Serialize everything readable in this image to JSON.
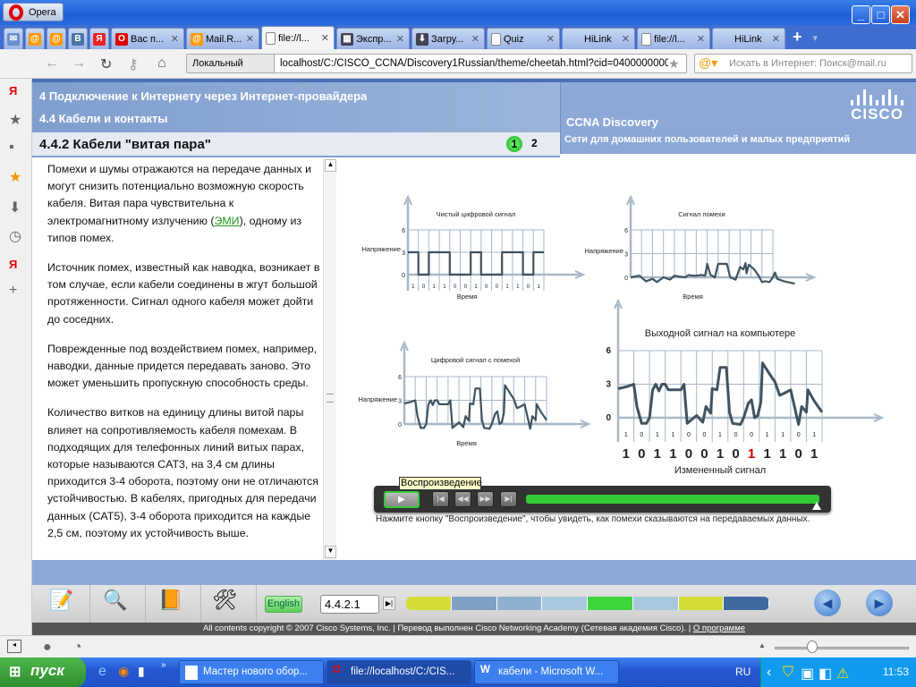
{
  "browser": {
    "menu_label": "Opera",
    "tabs": [
      {
        "label": "",
        "icon": "mail-icon"
      },
      {
        "label": "",
        "icon": "mailru-icon"
      },
      {
        "label": "",
        "icon": "search-icon"
      },
      {
        "label": "",
        "icon": "vk-icon"
      },
      {
        "label": "",
        "icon": "yandex-icon"
      },
      {
        "label": "Вас п...",
        "icon": "opera-icon"
      },
      {
        "label": "Mail.R...",
        "icon": "mailru-icon"
      },
      {
        "label": "file://l...",
        "icon": "page-icon",
        "active": true
      },
      {
        "label": "Экспр...",
        "icon": "speed-dial-icon"
      },
      {
        "label": "Загру...",
        "icon": "download-icon"
      },
      {
        "label": "Quiz",
        "icon": "page-icon"
      },
      {
        "label": "HiLink",
        "icon": ""
      },
      {
        "label": "file://l...",
        "icon": "page-icon"
      },
      {
        "label": "HiLink",
        "icon": ""
      }
    ],
    "address_badge": "Локальный",
    "url": "localhost/C:/CISCO_CCNA/Discovery1Russian/theme/cheetah.html?cid=0400000000&l1=t",
    "search_placeholder": "Искать в Интернет: Поиск@mail.ru"
  },
  "course": {
    "chapter": "4 Подключение к Интернету через Интернет-провайдера",
    "section": "4.4 Кабели и контакты",
    "topic": "4.4.2 Кабели \"витая пара\"",
    "pages": [
      "1",
      "2"
    ],
    "product": "CCNA Discovery",
    "subtitle": "Сети для домашних пользователей и малых предприятий",
    "logo": "CISCO"
  },
  "text": {
    "p1_a": "Помехи и шумы отражаются на передаче данных и могут снизить потенциально возможную скорость кабеля. Витая пара чувствительна к электромагнитному излучению (",
    "p1_link": "ЭМИ",
    "p1_b": "), одному из типов помех.",
    "p2": "Источник помех, известный как наводка, возникает в том случае, если кабели соединены в жгут большой протяженности. Сигнал одного кабеля может дойти до соседних.",
    "p3": "Поврежденные под воздействием помех, например, наводки, данные придется передавать заново. Это может уменьшить пропускную способность среды.",
    "p4": "Количество витков на единицу длины витой пары влияет на сопротивляемость кабеля помехам. В подходящих для телефонных линий витых парах, которые называются CAT3, на 3,4 см длины приходится 3-4 оборота, поэтому они не отличаются устойчивостью. В кабелях, пригодных для передачи данных (CAT5), 3-4 оборота приходится на каждые 2,5 см, поэтому их устойчивость выше."
  },
  "diagram": {
    "charts": [
      {
        "title": "Чистый цифровой сигнал",
        "ylabel": "Напряжение",
        "xlabel": "Время",
        "yticks": [
          "0",
          "3",
          "6"
        ],
        "bits": [
          "1",
          "0",
          "1",
          "1",
          "0",
          "0",
          "1",
          "0",
          "0",
          "1",
          "1",
          "0",
          "1"
        ],
        "signal": [
          [
            0,
            3
          ],
          [
            1,
            3
          ],
          [
            1,
            0
          ],
          [
            2,
            0
          ],
          [
            2,
            3
          ],
          [
            4,
            3
          ],
          [
            4,
            0
          ],
          [
            6,
            0
          ],
          [
            6,
            3
          ],
          [
            7,
            3
          ],
          [
            7,
            0
          ],
          [
            9,
            0
          ],
          [
            9,
            3
          ],
          [
            11,
            3
          ],
          [
            11,
            0
          ],
          [
            12,
            0
          ],
          [
            12,
            3
          ],
          [
            13,
            3
          ]
        ]
      },
      {
        "title": "Сигнал помехи",
        "ylabel": "Напряжение",
        "xlabel": "Время",
        "yticks": [
          "0",
          "3",
          "6"
        ],
        "bits": [],
        "signal": [
          [
            0,
            0
          ],
          [
            0.8,
            0.2
          ],
          [
            1.4,
            -0.5
          ],
          [
            2,
            -0.2
          ],
          [
            2.4,
            -0.6
          ],
          [
            3,
            0
          ],
          [
            3.6,
            -0.3
          ],
          [
            4,
            0.2
          ],
          [
            4.4,
            0.1
          ],
          [
            5,
            0
          ],
          [
            5.3,
            0.3
          ],
          [
            5.7,
            0.2
          ],
          [
            6,
            0.2
          ],
          [
            6.5,
            0.3
          ],
          [
            6.8,
            0.2
          ],
          [
            7,
            1.7
          ],
          [
            7.3,
            0.3
          ],
          [
            7.7,
            0
          ],
          [
            8,
            1.7
          ],
          [
            8.8,
            1.7
          ],
          [
            9.1,
            0
          ],
          [
            9.6,
            -0.3
          ],
          [
            10,
            1.3
          ],
          [
            10.3,
            1
          ],
          [
            10.5,
            1.8
          ],
          [
            10.6,
            0.5
          ],
          [
            10.8,
            1.6
          ],
          [
            11.3,
            1
          ],
          [
            11.7,
            0.2
          ],
          [
            12,
            -0.6
          ],
          [
            12.3,
            -0.5
          ],
          [
            12.7,
            -0.6
          ],
          [
            13,
            0
          ],
          [
            13.2,
            0.6
          ],
          [
            13.4,
            -0.2
          ],
          [
            14,
            -0.5
          ],
          [
            15,
            -0.8
          ]
        ]
      },
      {
        "title": "Цифровой сигнал с помехой",
        "ylabel": "Напряжение",
        "xlabel": "Время",
        "yticks": [
          "0",
          "3",
          "6"
        ],
        "bits": [],
        "signal_ref": 3
      },
      {
        "title": "Выходной сигнал на компьютере",
        "ylabel": "",
        "xlabel": "",
        "yticks": [
          "0",
          "3",
          "6"
        ],
        "bits": [
          "1",
          "0",
          "1",
          "1",
          "0",
          "0",
          "1",
          "0",
          "0",
          "1",
          "1",
          "0",
          "1"
        ],
        "received_bits": [
          "1",
          "0",
          "1",
          "1",
          "0",
          "0",
          "1",
          "0",
          "1",
          "1",
          "1",
          "0",
          "1"
        ],
        "changed_bit_index": 8,
        "changed_bit_color": "#cc0000",
        "caption": "Измененный сигнал",
        "signal": [
          [
            0,
            2.6
          ],
          [
            0.6,
            2.8
          ],
          [
            1,
            3
          ],
          [
            1.2,
            1
          ],
          [
            1.5,
            -0.5
          ],
          [
            1.8,
            -0.5
          ],
          [
            2,
            0
          ],
          [
            2.2,
            2.5
          ],
          [
            2.4,
            3
          ],
          [
            2.6,
            2.4
          ],
          [
            2.8,
            3
          ],
          [
            3,
            3
          ],
          [
            3.2,
            2.5
          ],
          [
            4,
            2.5
          ],
          [
            4.2,
            3
          ],
          [
            4.4,
            -0.5
          ],
          [
            5,
            0.2
          ],
          [
            5.4,
            -0.4
          ],
          [
            5.6,
            1
          ],
          [
            5.9,
            0.4
          ],
          [
            6,
            2.6
          ],
          [
            6.3,
            2.5
          ],
          [
            6.5,
            4.5
          ],
          [
            6.9,
            4.5
          ],
          [
            7.1,
            0.5
          ],
          [
            7.3,
            -0.5
          ],
          [
            7.8,
            -0.6
          ],
          [
            8,
            0
          ],
          [
            8.3,
            1.3
          ],
          [
            8.5,
            1.6
          ],
          [
            8.7,
            0
          ],
          [
            8.9,
            0.2
          ],
          [
            9.1,
            1.4
          ],
          [
            9.2,
            4.9
          ],
          [
            9.8,
            3.6
          ],
          [
            10,
            3.2
          ],
          [
            10.3,
            2
          ],
          [
            10.6,
            2.2
          ],
          [
            11,
            2.5
          ],
          [
            11.5,
            -0.6
          ],
          [
            11.7,
            1
          ],
          [
            12,
            0.5
          ],
          [
            12.1,
            2.5
          ],
          [
            12.5,
            1.5
          ],
          [
            13,
            0.5
          ]
        ]
      }
    ],
    "tooltip": "Воспроизведение",
    "instruction": "Нажмите кнопку \"Воспроизведение\", чтобы увидеть, как помехи сказываются на передаваемых данных.",
    "progress_percent": 100
  },
  "toolbar": {
    "language_button": "English",
    "page_input": "4.4.2.1",
    "segment_colors": [
      "#d4dc3a",
      "#7fa0c4",
      "#8fb0d0",
      "#a8c8e0",
      "#3dd43d",
      "#a8c8e0",
      "#d4dc3a",
      "#3e6aa0"
    ],
    "copyright": "All contents copyright © 2007 Cisco Systems, Inc. | Перевод выполнен Cisco Networking Academy (Сетевая академия Cisco). | ",
    "about_link": "О программе"
  },
  "taskbar": {
    "start": "пуск",
    "tasks": [
      "Мастер нового обор...",
      "file://localhost/C:/CIS...",
      "кабели - Microsoft W..."
    ],
    "lang": "RU",
    "clock": "11:53"
  }
}
